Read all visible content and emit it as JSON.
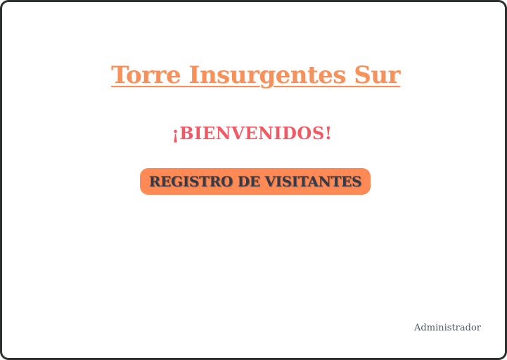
{
  "header": {
    "title": "Torre Insurgentes Sur",
    "welcome": "¡BIENVENIDOS!"
  },
  "actions": {
    "register_label": "REGISTRO DE VISITANTES",
    "admin_label": "Administrador"
  },
  "colors": {
    "title": "#f7915a",
    "welcome": "#ef5a64",
    "button_bg": "#ff8a55",
    "button_text": "#333b49",
    "frame_border": "#2c3130"
  }
}
